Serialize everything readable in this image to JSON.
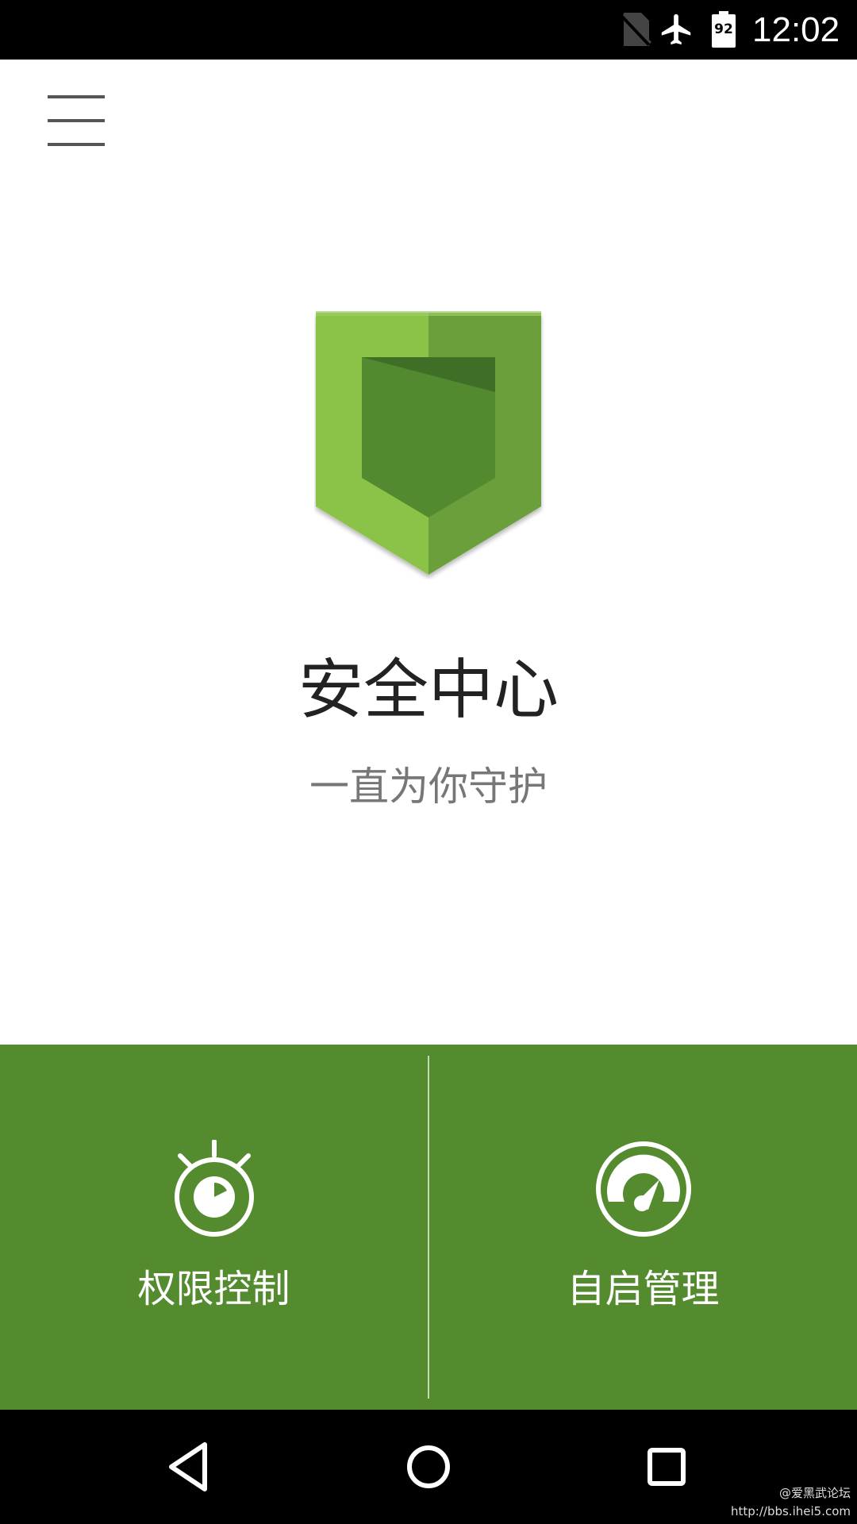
{
  "status_bar": {
    "time": "12:02",
    "battery_level": "92",
    "icons": [
      "no-sim-icon",
      "airplane-mode-icon",
      "battery-icon"
    ]
  },
  "header": {
    "menu_icon": "hamburger-menu-icon"
  },
  "hero": {
    "title": "安全中心",
    "subtitle": "一直为你守护",
    "logo_icon": "shield-logo-icon"
  },
  "actions": [
    {
      "label": "权限控制",
      "icon": "stopwatch-icon"
    },
    {
      "label": "自启管理",
      "icon": "speedometer-icon"
    }
  ],
  "nav_bar": {
    "icons": [
      "back-icon",
      "home-icon",
      "recent-apps-icon"
    ]
  },
  "watermark": {
    "line1": "@爱黑武论坛",
    "line2": "http://bbs.ihei5.com"
  },
  "colors": {
    "panel_green": "#558b2f",
    "shield_light": "#8bc34a",
    "shield_mid": "#6a9f3a",
    "shield_dark": "#538a30",
    "status_bar": "#000000"
  }
}
